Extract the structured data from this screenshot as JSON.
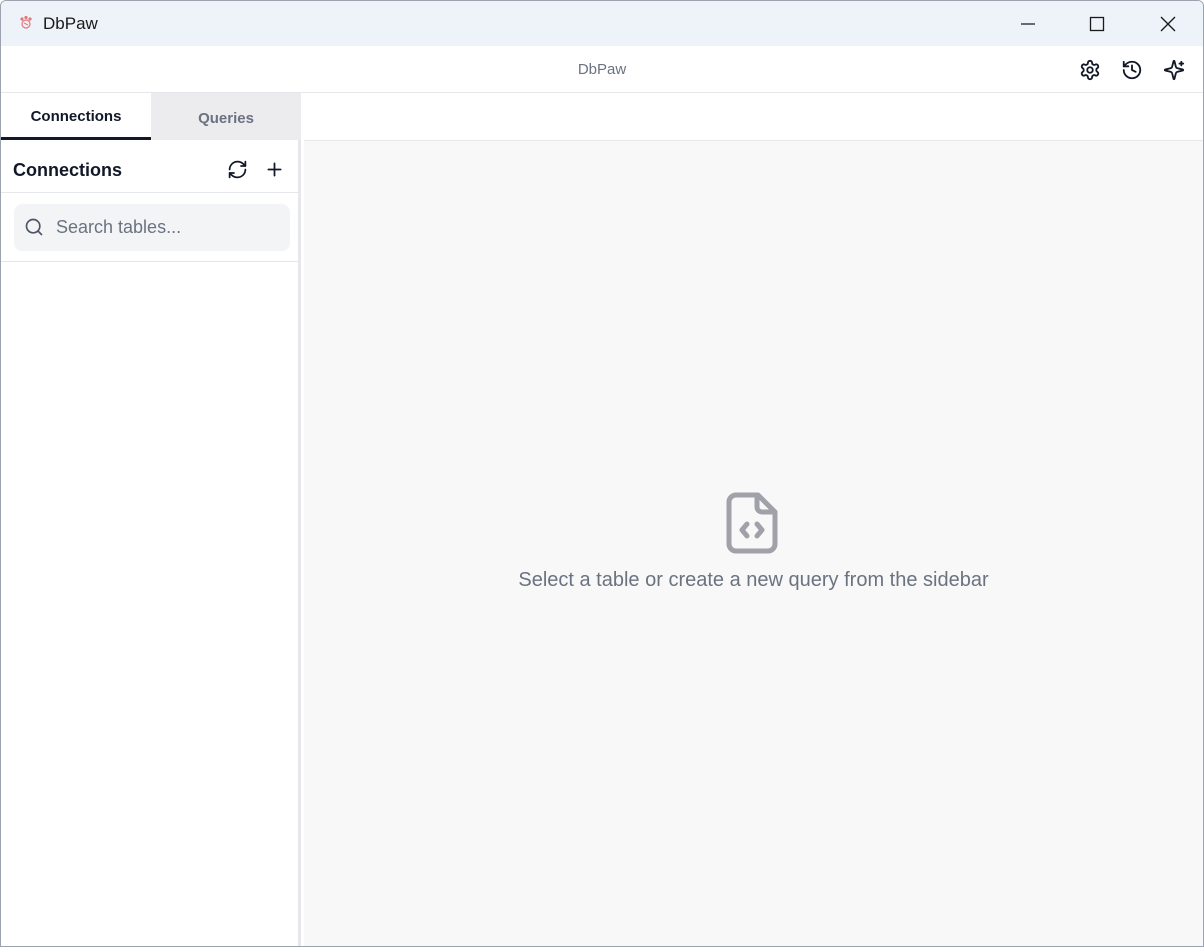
{
  "window": {
    "title": "DbPaw",
    "controls": {
      "minimize": "minimize",
      "maximize": "maximize",
      "close": "close"
    }
  },
  "header": {
    "title": "DbPaw",
    "actions": [
      "settings-icon",
      "history-icon",
      "sparkles-icon"
    ]
  },
  "sidebar": {
    "tabs": [
      {
        "label": "Connections",
        "active": true
      },
      {
        "label": "Queries",
        "active": false
      }
    ],
    "section_title": "Connections",
    "search": {
      "placeholder": "Search tables...",
      "value": ""
    }
  },
  "main": {
    "empty_state": {
      "icon": "file-code-icon",
      "message": "Select a table or create a new query from the sidebar"
    }
  },
  "colors": {
    "titlebar_bg": "#eef3fa",
    "muted_text": "#6b7280",
    "main_bg": "#f8f8f8",
    "active_tab_underline": "#111827"
  }
}
